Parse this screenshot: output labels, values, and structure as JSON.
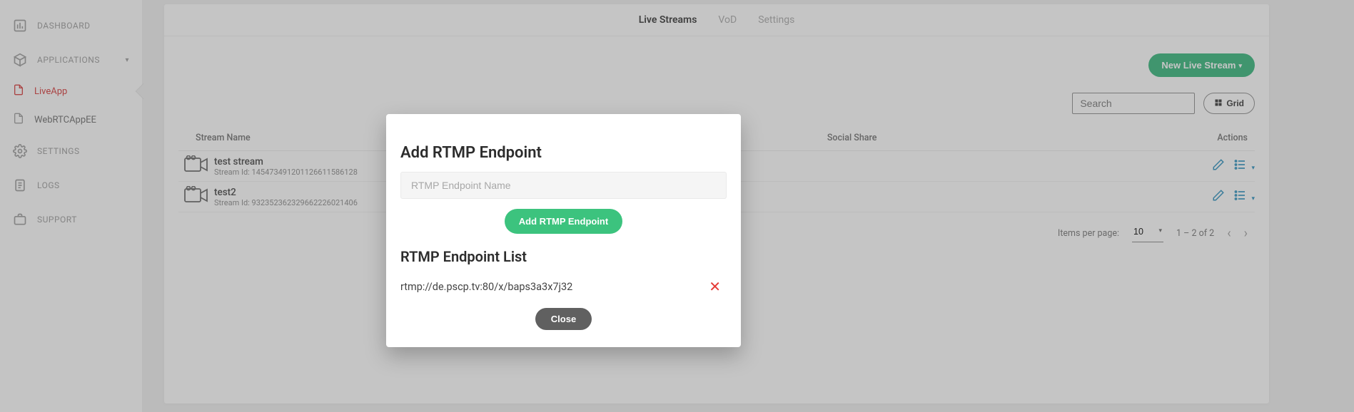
{
  "sidebar": {
    "items": [
      {
        "label": "DASHBOARD"
      },
      {
        "label": "APPLICATIONS"
      },
      {
        "label": "SETTINGS"
      },
      {
        "label": "LOGS"
      },
      {
        "label": "SUPPORT"
      }
    ],
    "apps": [
      {
        "label": "LiveApp",
        "active": true
      },
      {
        "label": "WebRTCAppEE",
        "active": false
      }
    ]
  },
  "tabs": {
    "live": "Live Streams",
    "vod": "VoD",
    "settings": "Settings"
  },
  "toolbar": {
    "new_stream": "New Live Stream",
    "grid": "Grid"
  },
  "search": {
    "placeholder": "Search"
  },
  "columns": {
    "name": "Stream Name",
    "social": "Social Share",
    "actions": "Actions"
  },
  "streams": [
    {
      "name": "test stream",
      "stream_id": "Stream Id: 145473491201126611586128"
    },
    {
      "name": "test2",
      "stream_id": "Stream Id: 932352362329662226021406"
    }
  ],
  "pager": {
    "items_per_page_label": "Items per page:",
    "items_per_page_value": "10",
    "range": "1 – 2 of 2"
  },
  "modal": {
    "title": "Add RTMP Endpoint",
    "placeholder": "RTMP Endpoint Name",
    "add_btn": "Add RTMP Endpoint",
    "list_title": "RTMP Endpoint List",
    "endpoints": [
      {
        "url": "rtmp://de.pscp.tv:80/x/baps3a3x7j32"
      }
    ],
    "close": "Close"
  }
}
